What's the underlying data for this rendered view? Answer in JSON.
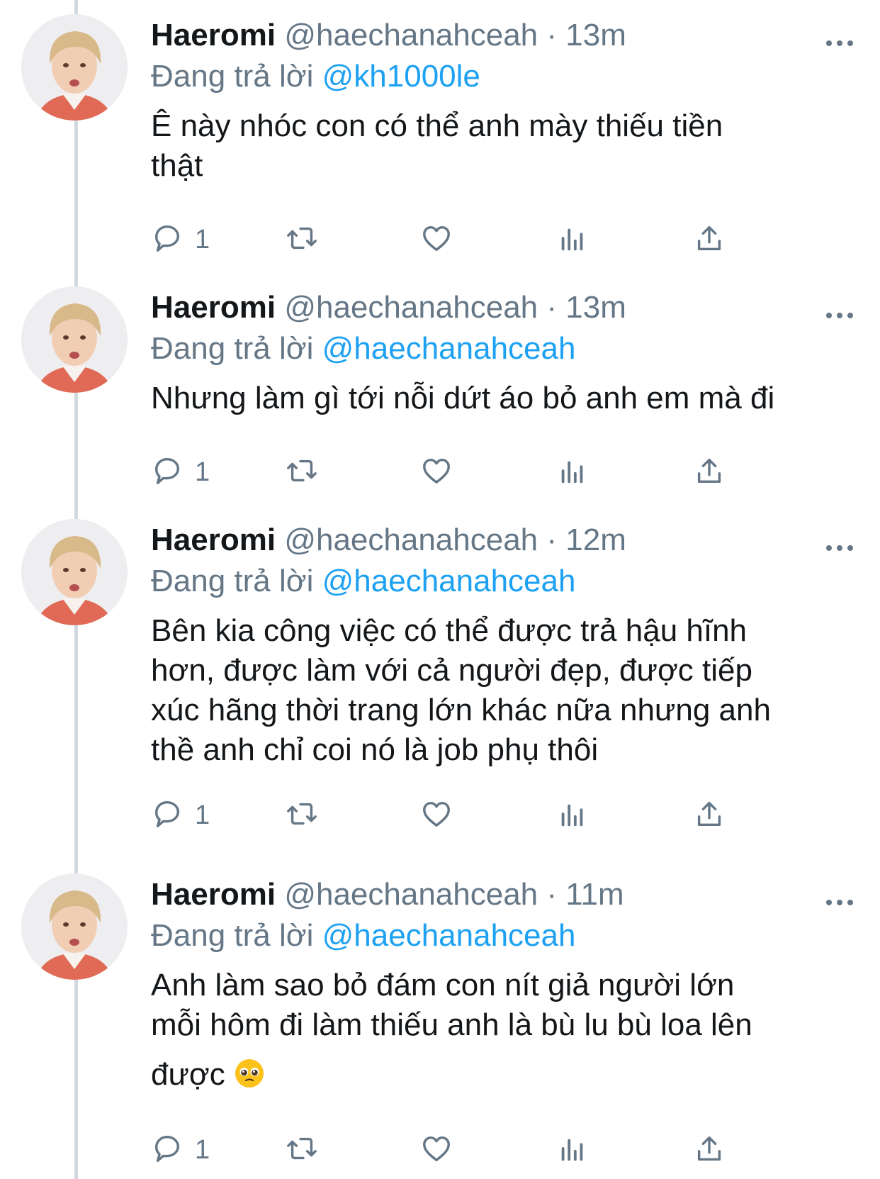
{
  "colors": {
    "accent": "#1da1f2",
    "secondary_text": "#657786",
    "primary_text": "#14171a"
  },
  "tweets": [
    {
      "name": "Haeromi",
      "handle": "@haechanahceah",
      "time": "· 13m",
      "reply_prefix": "Đang trả lời",
      "reply_to": "@kh1000le",
      "text_lines": [
        "Ê này nhóc con có thể anh mày thiếu tiền",
        "thật"
      ],
      "reply_count": "1"
    },
    {
      "name": "Haeromi",
      "handle": "@haechanahceah",
      "time": "· 13m",
      "reply_prefix": "Đang trả lời",
      "reply_to": "@haechanahceah",
      "text_lines": [
        "Nhưng làm gì tới nỗi dứt áo bỏ anh em mà đi"
      ],
      "reply_count": "1"
    },
    {
      "name": "Haeromi",
      "handle": "@haechanahceah",
      "time": "· 12m",
      "reply_prefix": "Đang trả lời",
      "reply_to": "@haechanahceah",
      "text_lines": [
        "Bên kia công việc có thể được trả hậu hĩnh",
        "hơn, được làm với cả người đẹp, được tiếp",
        "xúc hãng thời trang lớn khác nữa nhưng anh",
        "thề anh chỉ coi nó là job phụ thôi"
      ],
      "reply_count": "1"
    },
    {
      "name": "Haeromi",
      "handle": "@haechanahceah",
      "time": "· 11m",
      "reply_prefix": "Đang trả lời",
      "reply_to": "@haechanahceah",
      "text_lines": [
        "Anh làm sao bỏ đám con nít giả người lớn",
        "mỗi hôm đi làm thiếu anh là bù lu bù loa lên",
        "được"
      ],
      "text_emoji": "pleading-face-emoji",
      "reply_count": "1"
    }
  ],
  "icons": {
    "more": "more-horizontal-icon",
    "reply": "reply-bubble-icon",
    "retweet": "retweet-icon",
    "like": "heart-icon",
    "analytics": "analytics-bars-icon",
    "share": "share-upload-icon"
  }
}
